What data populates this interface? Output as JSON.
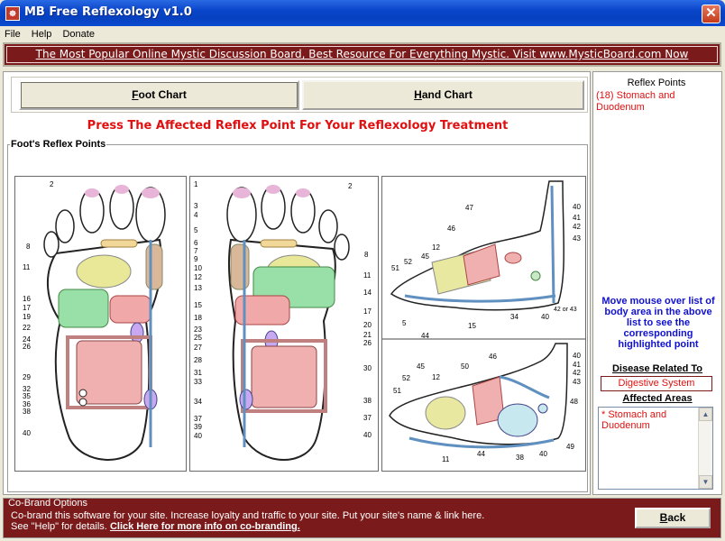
{
  "window": {
    "title": "MB Free Reflexology v1.0",
    "close_label": "✕"
  },
  "menu": {
    "items": [
      "File",
      "Help",
      "Donate"
    ]
  },
  "banner": {
    "text": "The Most Popular Online Mystic Discussion Board, Best Resource For Everything Mystic. Visit www.MysticBoard.com Now"
  },
  "tabs": {
    "foot": {
      "mnemonic": "F",
      "rest": "oot Chart"
    },
    "hand": {
      "mnemonic": "H",
      "rest": "and Chart"
    }
  },
  "main": {
    "instruction": "Press The Affected Reflex Point For Your Reflexology Treatment",
    "group_title": "Foot's Reflex Points",
    "left_numbers": [
      "2",
      "8",
      "11",
      "16",
      "17",
      "19",
      "22",
      "24",
      "26",
      "29",
      "32",
      "35",
      "36",
      "38",
      "40"
    ],
    "middle_numbers": [
      "1",
      "3",
      "4",
      "5",
      "6",
      "7",
      "9",
      "10",
      "12",
      "13",
      "15",
      "18",
      "23",
      "25",
      "27",
      "28",
      "31",
      "33",
      "34",
      "37",
      "39",
      "40"
    ],
    "middle_right_numbers": [
      "2",
      "8",
      "11",
      "14",
      "17",
      "20",
      "21",
      "26",
      "30",
      "38",
      "37",
      "40"
    ],
    "side_top_numbers": [
      "47",
      "46",
      "12",
      "45",
      "52",
      "51",
      "40",
      "41",
      "42",
      "43",
      "15",
      "34",
      "40",
      "44",
      "5",
      "42 or 43"
    ],
    "side_bottom_numbers": [
      "46",
      "50",
      "45",
      "12",
      "52",
      "51",
      "40",
      "41",
      "42",
      "43",
      "48",
      "49",
      "40",
      "38",
      "44",
      "11"
    ]
  },
  "right_panel": {
    "legend": "Reflex Points",
    "selected": "(18) Stomach and Duodenum",
    "help_text": "Move mouse over list of body area in the above list to see the corresponding highlighted point",
    "disease_label": "Disease Related To",
    "disease_value": "Digestive System",
    "areas_label": "Affected Areas",
    "areas_value": "* Stomach and Duodenum",
    "scroll_up_icon": "▲",
    "scroll_down_icon": "▼"
  },
  "footer": {
    "legend": "Co-Brand Options",
    "line1": "Co-brand this software for your site.  Increase loyalty and traffic to your site. Put your site's name &  link here.",
    "line2_prefix": "See \"Help\" for details.",
    "line2_link": "Click Here for more info on co-branding.",
    "back": {
      "mnemonic": "B",
      "rest": "ack"
    }
  },
  "colors": {
    "banner_bg": "#7a1a1a",
    "highlight_red": "#e01010",
    "help_blue": "#1010d0"
  }
}
